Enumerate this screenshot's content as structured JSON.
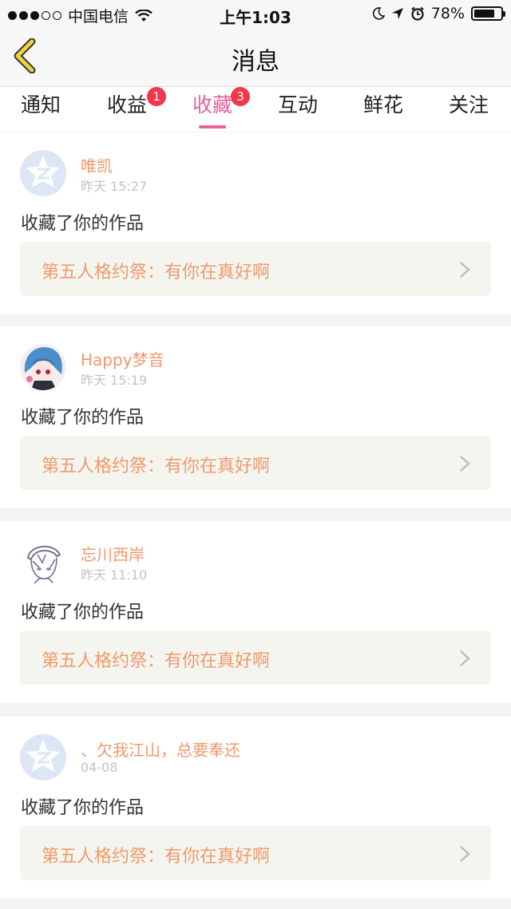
{
  "status_bar": {
    "carrier": "中国电信",
    "time": "上午1:03",
    "battery": "78%",
    "battery_level": 0.78,
    "icons": [
      "signal-icon",
      "wifi-icon",
      "moon-icon",
      "location-arrow-icon",
      "alarm-icon",
      "battery-icon"
    ]
  },
  "header": {
    "title": "消息",
    "back_icon": "chevron-left-icon"
  },
  "tabs": [
    {
      "label": "通知",
      "badge": ""
    },
    {
      "label": "收益",
      "badge": "1"
    },
    {
      "label": "收藏",
      "badge": "3",
      "active": true
    },
    {
      "label": "互动",
      "badge": ""
    },
    {
      "label": "鲜花",
      "badge": ""
    },
    {
      "label": "关注",
      "badge": ""
    }
  ],
  "messages": [
    {
      "user": "唯凯",
      "time": "昨天 15:27",
      "action": "收藏了你的作品",
      "work": "第五人格约祭：有你在真好啊",
      "avatar": "default-avatar-icon"
    },
    {
      "user": "Happy梦音",
      "time": "昨天 15:19",
      "action": "收藏了你的作品",
      "work": "第五人格约祭：有你在真好啊",
      "avatar": "anime-girl-avatar"
    },
    {
      "user": "忘川西岸",
      "time": "昨天 11:10",
      "action": "收藏了你的作品",
      "work": "第五人格约祭：有你在真好啊",
      "avatar": "anime-boy-sketch-avatar"
    },
    {
      "user": "、欠我江山，总要奉还",
      "time": "04-08",
      "action": "收藏了你的作品",
      "work": "第五人格约祭：有你在真好啊",
      "avatar": "default-avatar-icon"
    }
  ],
  "colors": {
    "accent": "#e8619a",
    "badge": "#f2374a",
    "username": "#ef9a6c",
    "link_bg": "#f5f5ef",
    "back_arrow": "#f0d23a"
  }
}
